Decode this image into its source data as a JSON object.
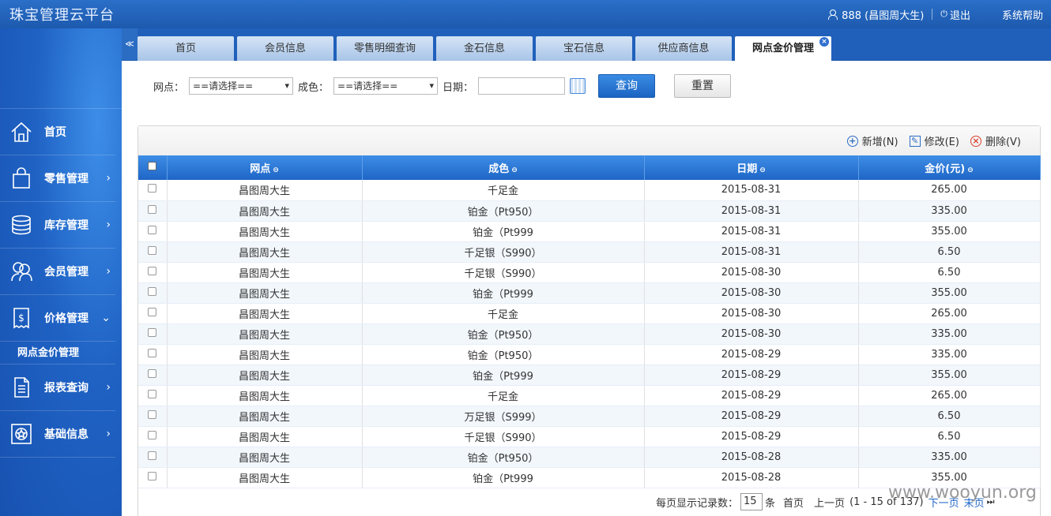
{
  "app": {
    "title": "珠宝管理云平台"
  },
  "header": {
    "user": "888 (昌图周大生)",
    "logout": "退出",
    "help": "系统帮助"
  },
  "sidebar": {
    "collapse": "≪",
    "items": [
      {
        "label": "首页",
        "arrow": ""
      },
      {
        "label": "零售管理",
        "arrow": "›"
      },
      {
        "label": "库存管理",
        "arrow": "›"
      },
      {
        "label": "会员管理",
        "arrow": "›"
      },
      {
        "label": "价格管理",
        "arrow": "⌄"
      },
      {
        "label": "报表查询",
        "arrow": "›"
      },
      {
        "label": "基础信息",
        "arrow": "›"
      }
    ],
    "sub": "网点金价管理"
  },
  "tabs": [
    "首页",
    "会员信息",
    "零售明细查询",
    "金石信息",
    "宝石信息",
    "供应商信息",
    "网点金价管理"
  ],
  "filter": {
    "outlet_label": "网点：",
    "outlet_value": "==请选择==",
    "purity_label": "成色：",
    "purity_value": "==请选择==",
    "date_label": "日期：",
    "query": "查询",
    "reset": "重置"
  },
  "toolbar": {
    "add": "新增(N)",
    "edit": "修改(E)",
    "delete": "删除(V)"
  },
  "table": {
    "headers": [
      "网点",
      "成色",
      "日期",
      "金价(元)"
    ],
    "rows": [
      [
        "昌图周大生",
        "千足金",
        "2015-08-31",
        "265.00"
      ],
      [
        "昌图周大生",
        "铂金（Pt950）",
        "2015-08-31",
        "335.00"
      ],
      [
        "昌图周大生",
        "铂金（Pt999",
        "2015-08-31",
        "355.00"
      ],
      [
        "昌图周大生",
        "千足银（S990）",
        "2015-08-31",
        "6.50"
      ],
      [
        "昌图周大生",
        "千足银（S990）",
        "2015-08-30",
        "6.50"
      ],
      [
        "昌图周大生",
        "铂金（Pt999",
        "2015-08-30",
        "355.00"
      ],
      [
        "昌图周大生",
        "千足金",
        "2015-08-30",
        "265.00"
      ],
      [
        "昌图周大生",
        "铂金（Pt950）",
        "2015-08-30",
        "335.00"
      ],
      [
        "昌图周大生",
        "铂金（Pt950）",
        "2015-08-29",
        "335.00"
      ],
      [
        "昌图周大生",
        "铂金（Pt999",
        "2015-08-29",
        "355.00"
      ],
      [
        "昌图周大生",
        "千足金",
        "2015-08-29",
        "265.00"
      ],
      [
        "昌图周大生",
        "万足银（S999）",
        "2015-08-29",
        "6.50"
      ],
      [
        "昌图周大生",
        "千足银（S990）",
        "2015-08-29",
        "6.50"
      ],
      [
        "昌图周大生",
        "铂金（Pt950）",
        "2015-08-28",
        "335.00"
      ],
      [
        "昌图周大生",
        "铂金（Pt999",
        "2015-08-28",
        "355.00"
      ]
    ]
  },
  "pager": {
    "per_page_label": "每页显示记录数：",
    "per_page": "15",
    "unit": "条",
    "first": "首页",
    "prev": "上一页",
    "range": "(1 - 15 of 137)",
    "next": "下一页",
    "last": "末页"
  },
  "watermark": "www.wooyun.org"
}
